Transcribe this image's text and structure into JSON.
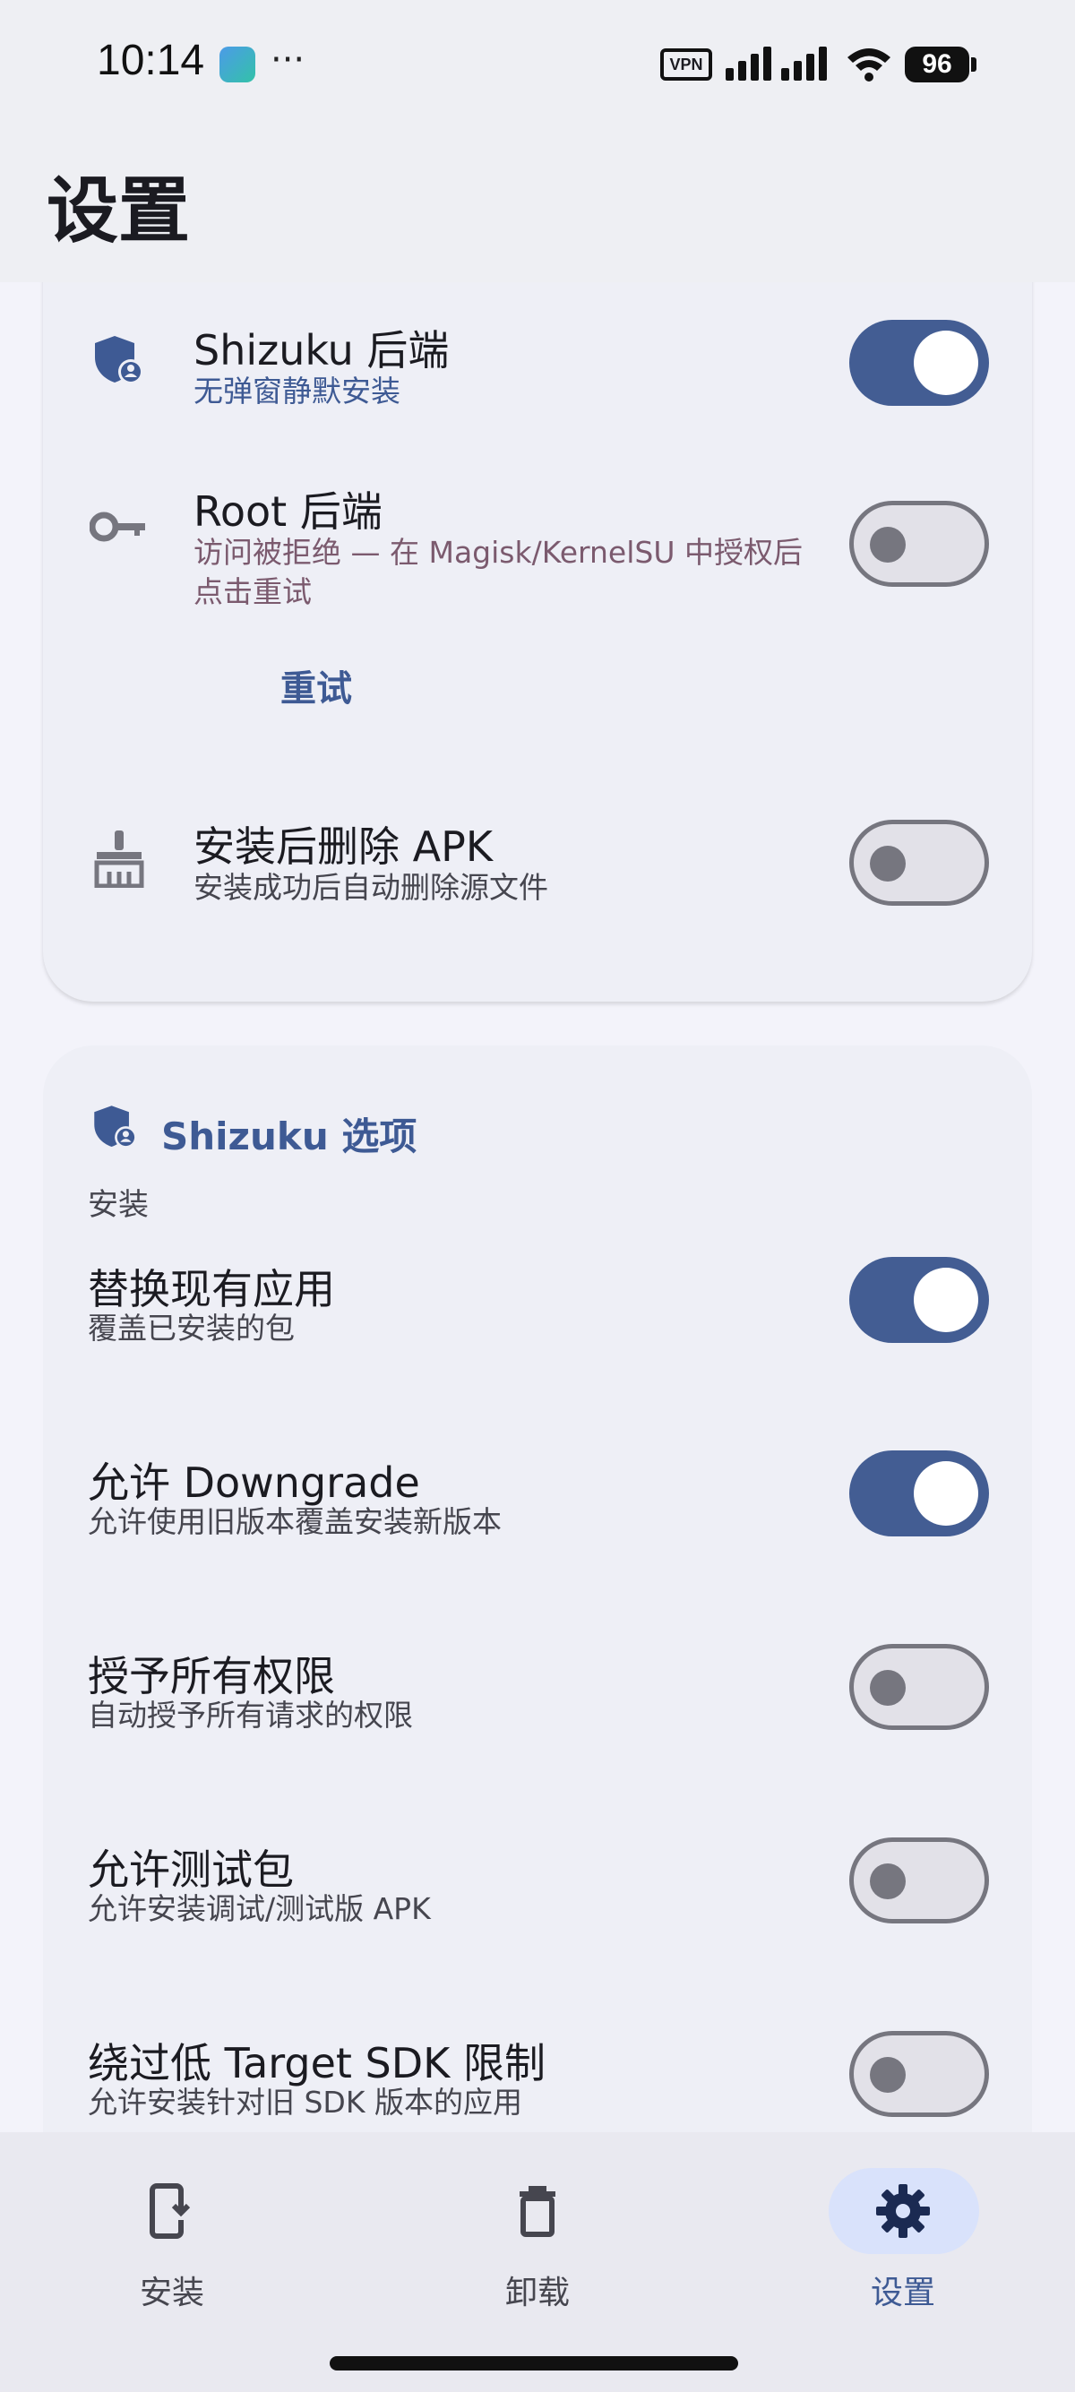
{
  "status_bar": {
    "time": "10:14",
    "more": "···",
    "vpn": "VPN",
    "battery": "96"
  },
  "page_title": "设置",
  "backend_card": {
    "shizuku": {
      "title": "Shizuku 后端",
      "subtitle": "无弹窗静默安装",
      "enabled": true,
      "icon": "shield-person-icon"
    },
    "root": {
      "title": "Root 后端",
      "subtitle": "访问被拒绝 — 在 Magisk/KernelSU 中授权后点击重试",
      "enabled": false,
      "icon": "key-icon",
      "retry_label": "重试"
    },
    "delete_apk": {
      "title": "安装后删除 APK",
      "subtitle": "安装成功后自动删除源文件",
      "enabled": false,
      "icon": "broom-icon"
    }
  },
  "shizuku_options": {
    "header": "Shizuku 选项",
    "group_label": "安装",
    "items": [
      {
        "title": "替换现有应用",
        "subtitle": "覆盖已安装的包",
        "enabled": true
      },
      {
        "title": "允许 Downgrade",
        "subtitle": "允许使用旧版本覆盖安装新版本",
        "enabled": true
      },
      {
        "title": "授予所有权限",
        "subtitle": "自动授予所有请求的权限",
        "enabled": false
      },
      {
        "title": "允许测试包",
        "subtitle": "允许安装调试/测试版 APK",
        "enabled": false
      },
      {
        "title": "绕过低 Target SDK 限制",
        "subtitle": "允许安装针对旧 SDK 版本的应用",
        "enabled": false
      }
    ]
  },
  "bottom_nav": [
    {
      "label": "安装",
      "icon": "phone-download-icon",
      "active": false
    },
    {
      "label": "卸载",
      "icon": "trash-icon",
      "active": false
    },
    {
      "label": "设置",
      "icon": "gear-icon",
      "active": true
    }
  ],
  "colors": {
    "accent": "#435d93",
    "switch_off": "#e2e1e8",
    "background": "#f3f3fa"
  }
}
